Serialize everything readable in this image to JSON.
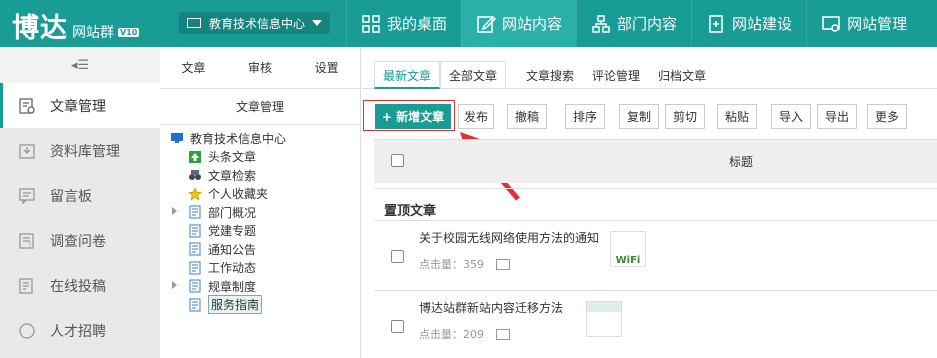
{
  "header": {
    "logo": "博达",
    "logo_sub": "网站群",
    "logo_version": "V10",
    "site_selector": "教育技术信息中心",
    "nav": [
      "我的桌面",
      "网站内容",
      "部门内容",
      "网站建设",
      "网站管理"
    ]
  },
  "sidebar": {
    "collapse_glyph": "◂☰",
    "items": [
      "文章管理",
      "资料库管理",
      "留言板",
      "调查问卷",
      "在线投稿",
      "人才招聘"
    ]
  },
  "tree": {
    "tabs": [
      "文章",
      "审核",
      "设置"
    ],
    "title": "文章管理",
    "nodes": [
      "教育技术信息中心",
      "头条文章",
      "文章检索",
      "个人收藏夹",
      "部门概况",
      "党建专题",
      "通知公告",
      "工作动态",
      "规章制度",
      "服务指南"
    ]
  },
  "main": {
    "tabs": [
      "最新文章",
      "全部文章",
      "文章搜索",
      "评论管理",
      "归档文章"
    ],
    "toolbar": [
      "+ 新增文章",
      "发布",
      "撤稿",
      "排序",
      "复制",
      "剪切",
      "粘贴",
      "导入",
      "导出",
      "更多"
    ],
    "table_header_title": "标题",
    "section": "置顶文章",
    "rows": [
      {
        "title": "关于校园无线网络使用方法的通知",
        "clicks_label": "点击量：",
        "clicks": "359",
        "thumb_text": "WiFi"
      },
      {
        "title": "博达站群新站内容迁移方法",
        "clicks_label": "点击量：",
        "clicks": "209"
      }
    ]
  },
  "colors": {
    "brand": "#199c95",
    "highlight": "#e03030"
  }
}
